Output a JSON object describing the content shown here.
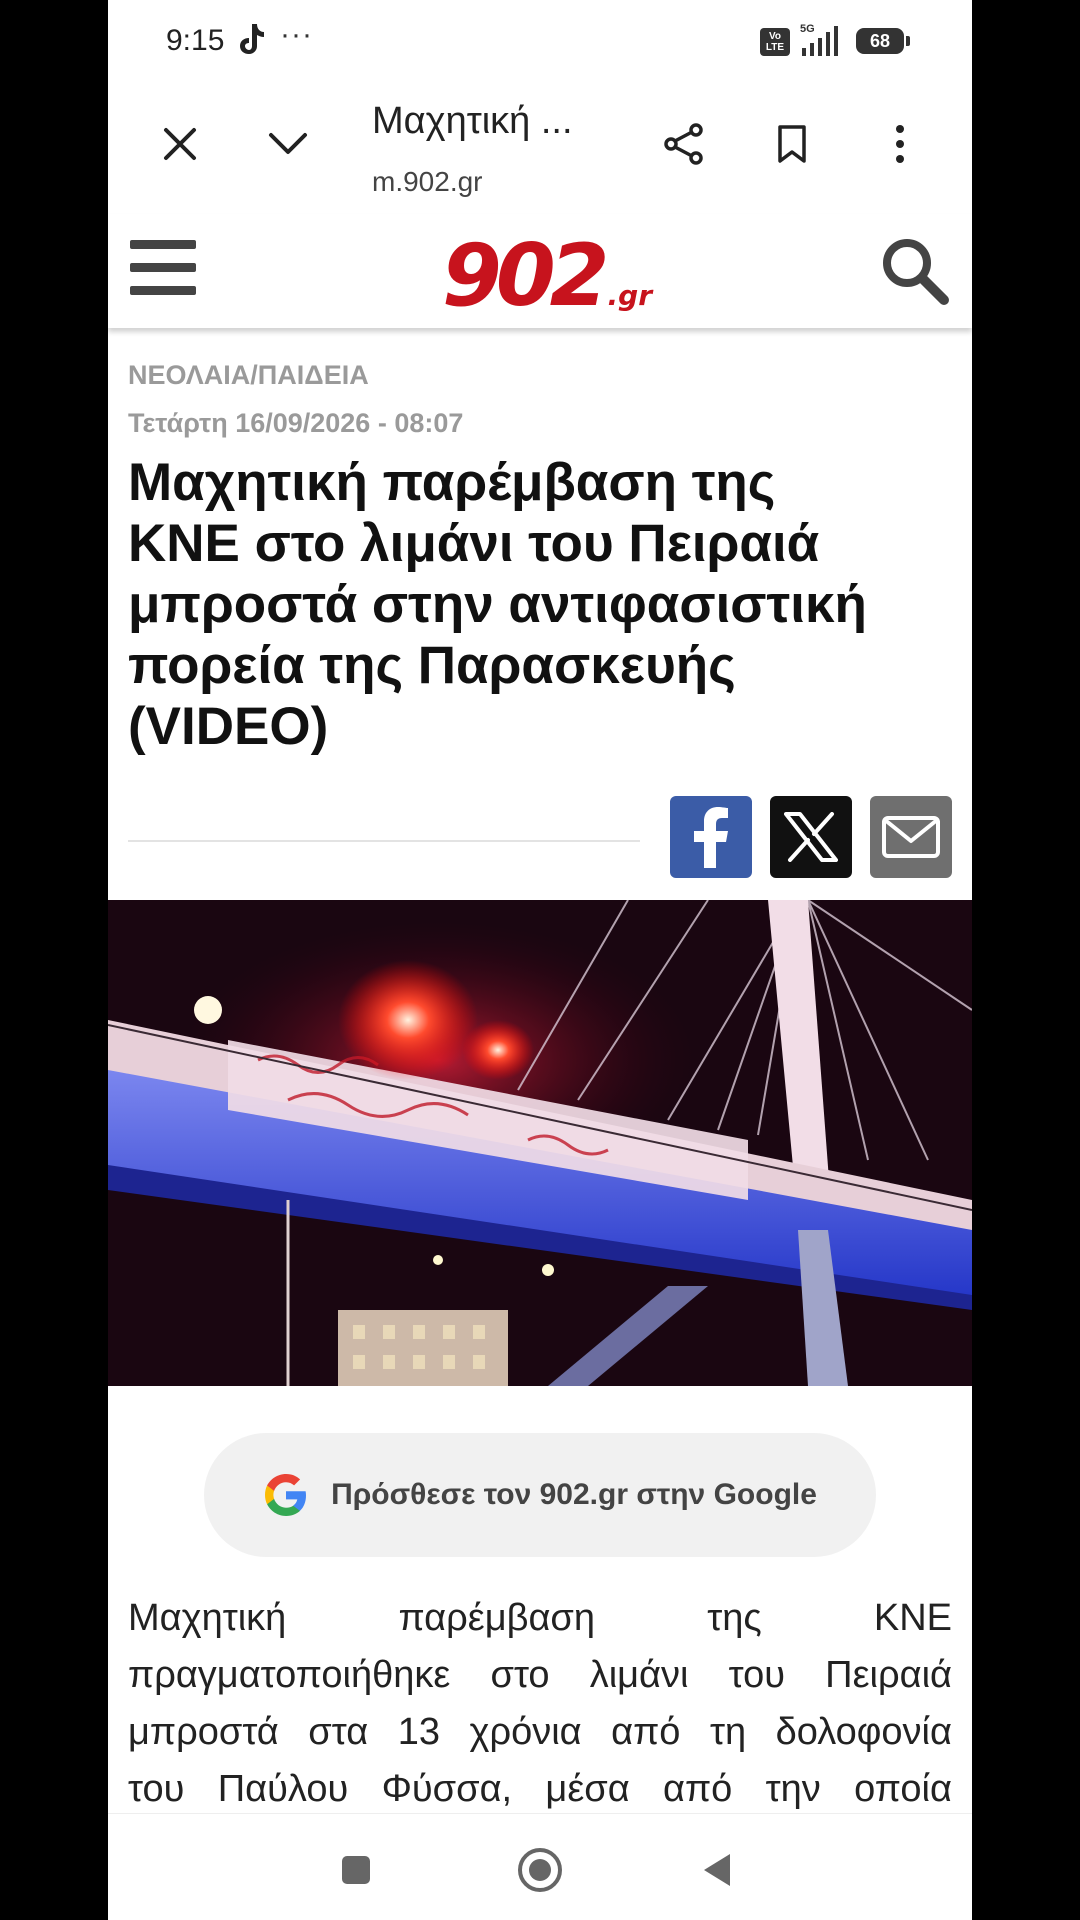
{
  "status_bar": {
    "time": "9:15",
    "dots": "···",
    "volte": "Vo LTE",
    "network": "5G",
    "battery": "68"
  },
  "browser": {
    "title": "Μαχητική ...",
    "url": "m.902.gr",
    "icons": [
      "close-icon",
      "chevron-down-icon",
      "share-icon",
      "bookmark-icon",
      "more-vert-icon"
    ]
  },
  "site": {
    "logo_number": "902",
    "logo_suffix": ".gr",
    "logo_color": "#c7131d"
  },
  "article": {
    "category": "ΝΕΟΛΑΙΑ/ΠΑΙΔΕΙΑ",
    "date": "Τετάρτη 16/09/2026 - 08:07",
    "headline_lines": [
      "Μαχητική παρέμβαση της",
      "ΚΝΕ στο λιμάνι του Πειραιά",
      "μπροστά στην αντιφασιστική",
      "πορεία της Παρασκευής",
      "(VIDEO)"
    ],
    "share": [
      "facebook-icon",
      "x-icon",
      "mail-icon"
    ],
    "google_cta": "Πρόσθεσε τον 902.gr στην Google",
    "body_lines": [
      "Μαχητική παρέμβαση της ΚΝΕ",
      "πραγματοποιήθηκε στο λιμάνι του Πειραιά",
      "μπροστά στα 13 χρόνια από τη δολοφονία",
      "του Παύλου Φύσσα, μέσα από την οποία"
    ]
  },
  "nav": {
    "buttons": [
      "recents-button",
      "home-button",
      "back-button"
    ]
  }
}
